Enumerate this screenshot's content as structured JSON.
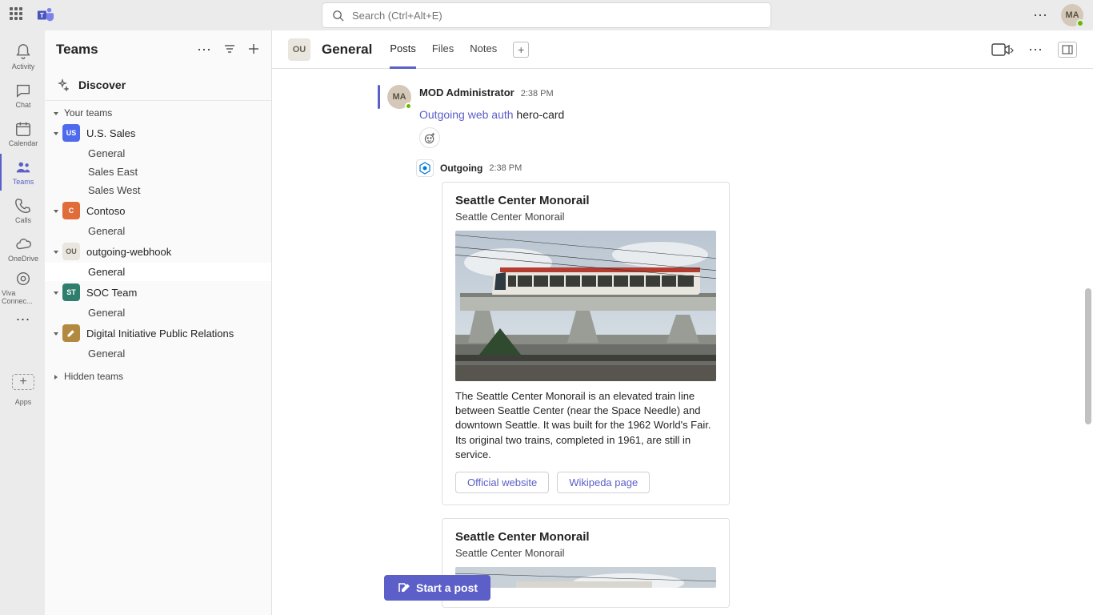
{
  "topbar": {
    "search_placeholder": "Search (Ctrl+Alt+E)",
    "user_initials": "MA"
  },
  "rail": {
    "items": [
      {
        "label": "Activity"
      },
      {
        "label": "Chat"
      },
      {
        "label": "Calendar"
      },
      {
        "label": "Teams"
      },
      {
        "label": "Calls"
      },
      {
        "label": "OneDrive"
      },
      {
        "label": "Viva Connec..."
      }
    ],
    "apps_label": "Apps"
  },
  "panel": {
    "title": "Teams",
    "discover": "Discover",
    "your_teams": "Your teams",
    "hidden_teams": "Hidden teams",
    "teams": [
      {
        "initials": "US",
        "name": "U.S. Sales",
        "color": "#4f6bed",
        "channels": [
          "General",
          "Sales East",
          "Sales West"
        ]
      },
      {
        "initials": "C",
        "name": "Contoso",
        "color": "#e06c3a",
        "channels": [
          "General"
        ]
      },
      {
        "initials": "OU",
        "name": "outgoing-webhook",
        "color": "#e8e6df",
        "text": "#6b6353",
        "channels": [
          "General"
        ]
      },
      {
        "initials": "ST",
        "name": "SOC Team",
        "color": "#2f7d6d",
        "channels": [
          "General"
        ]
      },
      {
        "initials": "",
        "name": "Digital Initiative Public Relations",
        "color": "#b3893f",
        "icon": "pencil",
        "channels": [
          "General"
        ]
      }
    ]
  },
  "channel": {
    "avatar": "OU",
    "name": "General",
    "tabs": [
      "Posts",
      "Files",
      "Notes"
    ]
  },
  "message": {
    "author": "MOD Administrator",
    "avatar": "MA",
    "time": "2:38 PM",
    "link_text": "Outgoing web auth",
    "body_rest": " hero-card"
  },
  "bot": {
    "name": "Outgoing",
    "time": "2:38 PM"
  },
  "cards": [
    {
      "title": "Seattle Center Monorail",
      "subtitle": "Seattle Center Monorail",
      "text": "The Seattle Center Monorail is an elevated train line between Seattle Center (near the Space Needle) and downtown Seattle. It was built for the 1962 World's Fair. Its original two trains, completed in 1961, are still in service.",
      "buttons": [
        "Official website",
        "Wikipeda page"
      ]
    },
    {
      "title": "Seattle Center Monorail",
      "subtitle": "Seattle Center Monorail"
    }
  ],
  "compose": {
    "label": "Start a post"
  }
}
